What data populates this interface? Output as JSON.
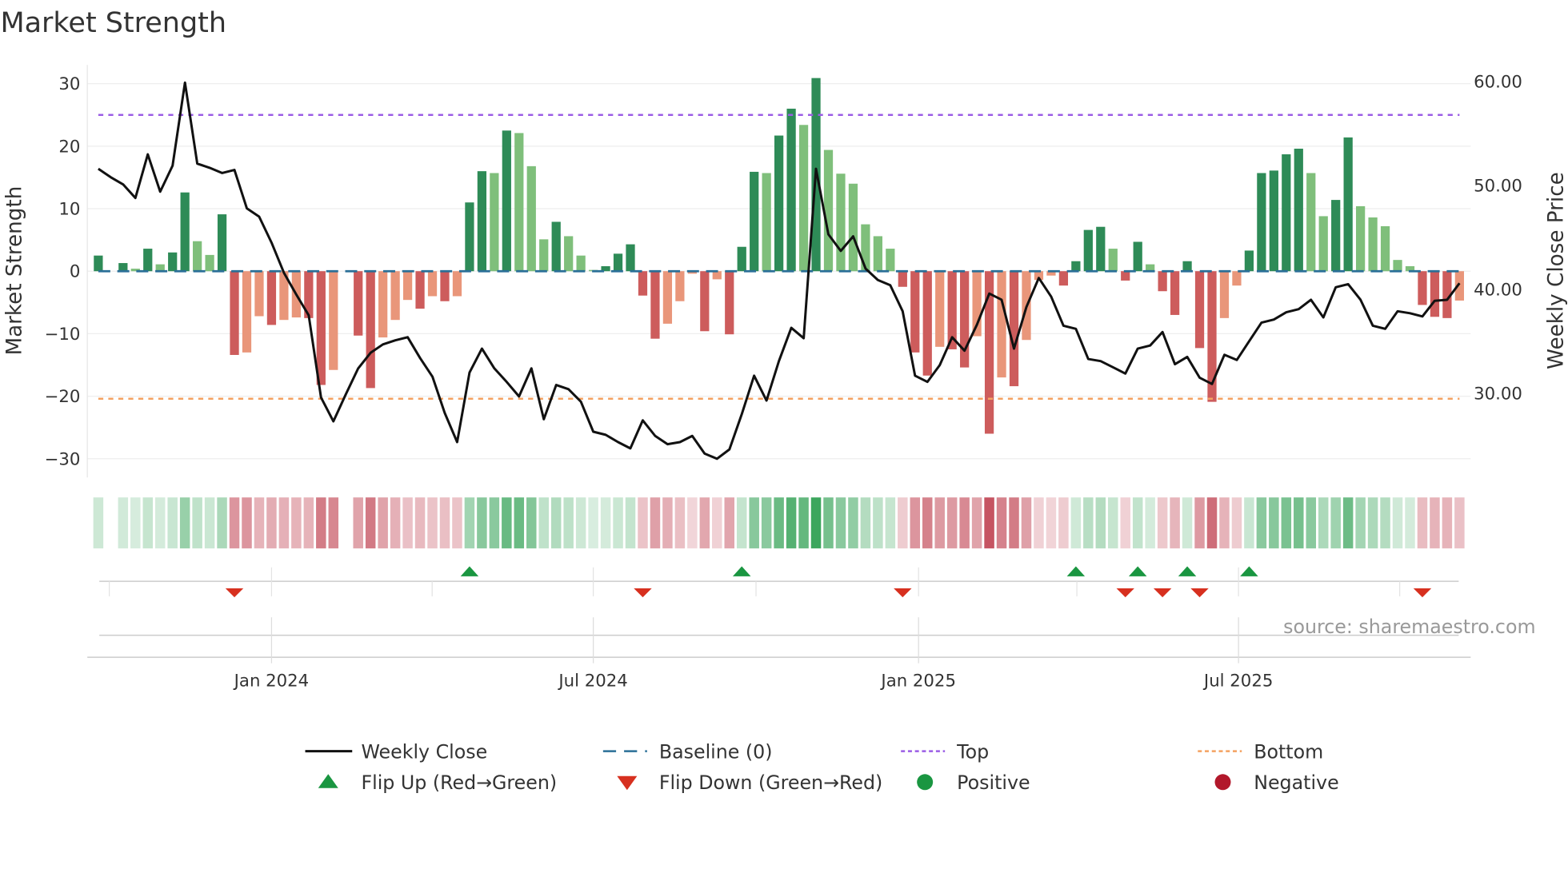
{
  "chart_data": {
    "type": "bar",
    "title": "Market Strength",
    "ylabel": "Market Strength",
    "y2label": "Weekly Close Price",
    "source": "source: sharemaestro.com",
    "ylim": [
      -33,
      33
    ],
    "y2lim": [
      21.9,
      61.6
    ],
    "yticks": [
      30,
      20,
      10,
      0,
      -10,
      -20,
      -30
    ],
    "yticklabels": [
      "30",
      "20",
      "10",
      "0",
      "−10",
      "−20",
      "−30"
    ],
    "y2ticks": [
      60,
      50,
      40,
      30
    ],
    "y2ticklabels": [
      "60.00",
      "50.00",
      "40.00",
      "30.00"
    ],
    "x_start_date": "2023-09-25",
    "x_frequency": "weekly",
    "xticks": [
      {
        "date": "2024-01-01",
        "label": "Jan 2024"
      },
      {
        "date": "2024-07-01",
        "label": "Jul 2024"
      },
      {
        "date": "2025-01-01",
        "label": "Jan 2025"
      },
      {
        "date": "2025-07-01",
        "label": "Jul 2025"
      }
    ],
    "top_level": 25,
    "bottom_level": -20.4,
    "baseline": 0,
    "strength": [
      2.5,
      0,
      1.3,
      0.4,
      3.6,
      1.1,
      3.0,
      12.6,
      4.8,
      2.6,
      9.1,
      -13.4,
      -13.0,
      -7.2,
      -8.6,
      -7.8,
      -7.4,
      -7.5,
      -18.2,
      -15.8,
      0,
      -10.3,
      -18.7,
      -10.6,
      -7.8,
      -4.6,
      -6.0,
      -4.0,
      -4.8,
      -4.0,
      11.0,
      16.0,
      15.7,
      22.5,
      22.1,
      16.8,
      5.1,
      7.9,
      5.6,
      2.5,
      0.2,
      0.8,
      2.8,
      4.3,
      -3.9,
      -10.8,
      -8.4,
      -4.8,
      -0.4,
      -9.6,
      -1.3,
      -10.1,
      3.9,
      15.9,
      15.7,
      21.7,
      26.0,
      23.4,
      30.9,
      19.4,
      15.6,
      14.0,
      7.5,
      5.6,
      3.6,
      -2.5,
      -13.0,
      -16.7,
      -12.1,
      -12.5,
      -15.4,
      -10.4,
      -26.0,
      -17.0,
      -18.4,
      -11.0,
      -1.4,
      -0.7,
      -2.3,
      1.6,
      6.6,
      7.1,
      3.6,
      -1.5,
      4.7,
      1.1,
      -3.2,
      -7.0,
      1.6,
      -12.3,
      -20.9,
      -7.5,
      -2.3,
      3.3,
      15.7,
      16.1,
      18.7,
      19.6,
      15.7,
      8.8,
      11.4,
      21.4,
      10.4,
      8.6,
      7.2,
      1.8,
      0.8,
      -5.4,
      -7.3,
      -7.5,
      -4.7
    ],
    "weekly_close": [
      51.6,
      50.8,
      50.1,
      48.8,
      53.0,
      49.4,
      51.9,
      59.9,
      52.1,
      51.7,
      51.2,
      51.5,
      47.8,
      47.0,
      44.5,
      41.6,
      39.5,
      37.5,
      29.6,
      27.3,
      29.9,
      32.4,
      33.9,
      34.7,
      35.1,
      35.4,
      33.4,
      31.6,
      28.1,
      25.3,
      32.0,
      34.3,
      32.4,
      31.1,
      29.7,
      32.4,
      27.5,
      30.8,
      30.4,
      29.2,
      26.3,
      26.0,
      25.3,
      24.7,
      27.4,
      25.9,
      25.1,
      25.3,
      25.9,
      24.2,
      23.7,
      24.6,
      28.0,
      31.7,
      29.3,
      33.1,
      36.3,
      35.3,
      51.6,
      45.3,
      43.7,
      45.1,
      42.0,
      40.9,
      40.4,
      37.9,
      31.7,
      31.1,
      32.7,
      35.4,
      34.1,
      36.6,
      39.6,
      39.0,
      34.3,
      38.3,
      41.1,
      39.3,
      36.5,
      36.2,
      33.3,
      33.1,
      32.5,
      31.9,
      34.3,
      34.6,
      35.9,
      32.8,
      33.5,
      31.5,
      30.9,
      33.7,
      33.2,
      35.0,
      36.8,
      37.1,
      37.8,
      38.1,
      39.0,
      37.3,
      40.2,
      40.5,
      39.0,
      36.5,
      36.2,
      37.9,
      37.7,
      37.4,
      38.9,
      39.0,
      40.6
    ],
    "flip_up_weeks": [
      30,
      52,
      79,
      84,
      88,
      93
    ],
    "flip_down_weeks": [
      11,
      44,
      65,
      83,
      86,
      89,
      107
    ],
    "legend": [
      {
        "label": "Weekly Close",
        "marker": "line"
      },
      {
        "label": "Baseline (0)",
        "marker": "dashed"
      },
      {
        "label": "Top",
        "marker": "dotted-purple"
      },
      {
        "label": "Bottom",
        "marker": "dotted-orange"
      },
      {
        "label": "Flip Up (Red→Green)",
        "marker": "triangle-up"
      },
      {
        "label": "Flip Down (Green→Red)",
        "marker": "triangle-down"
      },
      {
        "label": "Positive",
        "marker": "circle-green"
      },
      {
        "label": "Negative",
        "marker": "circle-red"
      }
    ],
    "legend_position": "bottom-center",
    "grid": true
  },
  "colors": {
    "pos_strong": "#2e8b57",
    "pos_weak": "#7fbf7b",
    "neg_strong": "#cd5c5c",
    "neg_weak": "#e9967a",
    "close": "#111111",
    "baseline": "#2a6f97",
    "top": "#9b5de5",
    "bottom": "#f4a261",
    "flip_up": "#1a9641",
    "flip_down": "#d7301f",
    "positive": "#1a9641",
    "negative": "#b2182b"
  }
}
